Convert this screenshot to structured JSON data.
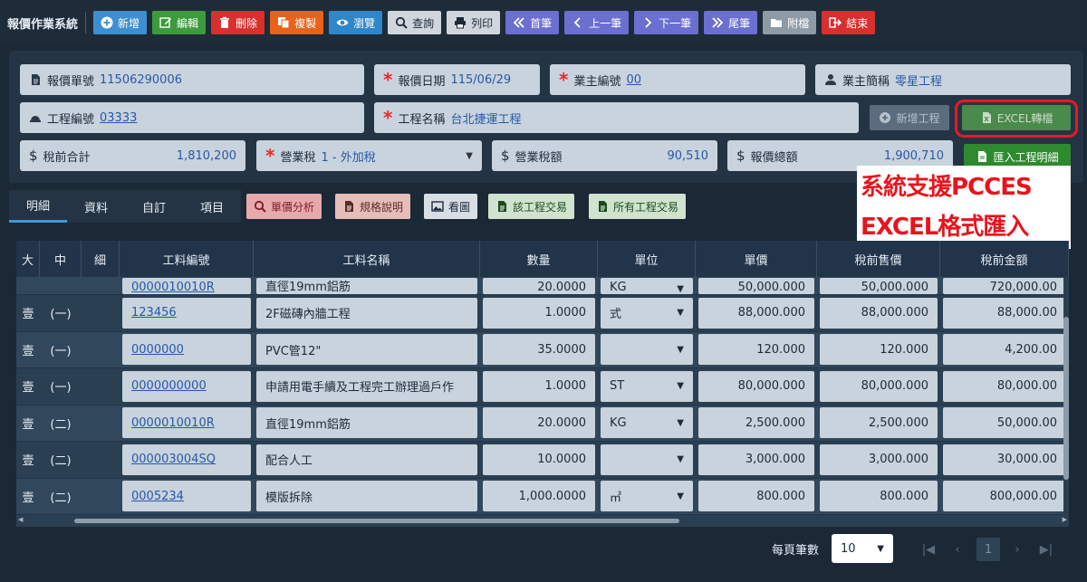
{
  "app_title": "報價作業系統",
  "toolbar": [
    {
      "name": "add-button",
      "label": "新增",
      "icon": "plus-circle-icon",
      "color": "c-blue"
    },
    {
      "name": "edit-button",
      "label": "編輯",
      "icon": "edit-icon",
      "color": "c-green"
    },
    {
      "name": "delete-button",
      "label": "刪除",
      "icon": "trash-icon",
      "color": "c-red"
    },
    {
      "name": "copy-button",
      "label": "複製",
      "icon": "copy-icon",
      "color": "c-orange"
    },
    {
      "name": "browse-button",
      "label": "瀏覽",
      "icon": "eye-icon",
      "color": "c-sky"
    },
    {
      "name": "query-button",
      "label": "查詢",
      "icon": "search-icon",
      "color": "c-gray"
    },
    {
      "name": "print-button",
      "label": "列印",
      "icon": "printer-icon",
      "color": "c-gray"
    },
    {
      "name": "first-record-button",
      "label": "首筆",
      "icon": "double-chevron-left-icon",
      "color": "c-purple"
    },
    {
      "name": "prev-record-button",
      "label": "上一筆",
      "icon": "chevron-left-icon",
      "color": "c-purple"
    },
    {
      "name": "next-record-button",
      "label": "下一筆",
      "icon": "chevron-right-icon",
      "color": "c-purple"
    },
    {
      "name": "last-record-button",
      "label": "尾筆",
      "icon": "double-chevron-right-icon",
      "color": "c-purple"
    },
    {
      "name": "attachment-button",
      "label": "附檔",
      "icon": "folder-icon",
      "color": "c-slate"
    },
    {
      "name": "exit-button",
      "label": "結束",
      "icon": "sign-out-icon",
      "color": "c-red"
    }
  ],
  "form": {
    "quote_no_label": "報價單號",
    "quote_no": "11506290006",
    "quote_date_label": "報價日期",
    "quote_date": "115/06/29",
    "owner_code_label": "業主編號",
    "owner_code": "00",
    "owner_name_label": "業主簡稱",
    "owner_name": "零星工程",
    "project_code_label": "工程編號",
    "project_code": "03333",
    "project_name_label": "工程名稱",
    "project_name": "台北捷運工程",
    "pretax_label": "稅前合計",
    "pretax": "1,810,200",
    "tax_type_label": "營業稅",
    "tax_type": "1 - 外加稅",
    "tax_amount_label": "營業稅額",
    "tax_amount": "90,510",
    "total_label": "報價總額",
    "total": "1,900,710"
  },
  "side_buttons": {
    "add_project": "新增工程",
    "excel": "EXCEL轉檔",
    "import": "匯入工程明細"
  },
  "callout": {
    "line1": "系統支援PCCES",
    "line2": "EXCEL格式匯入"
  },
  "tabs": [
    "明細",
    "資料",
    "自訂",
    "項目"
  ],
  "sub_buttons": [
    {
      "name": "unit-price-analysis-button",
      "label": "單價分析",
      "color": "c-pink",
      "icon": "search-icon"
    },
    {
      "name": "spec-description-button",
      "label": "規格說明",
      "color": "c-tan",
      "icon": "document-icon"
    },
    {
      "name": "view-image-button",
      "label": "看圖",
      "color": "c-lgray",
      "icon": "image-icon"
    },
    {
      "name": "project-transactions-button",
      "label": "該工程交易",
      "color": "c-lgreen",
      "icon": "document-icon"
    },
    {
      "name": "all-project-transactions-button",
      "label": "所有工程交易",
      "color": "c-lgreen",
      "icon": "document-icon"
    }
  ],
  "grid": {
    "columns": [
      "大",
      "中",
      "細",
      "工料編號",
      "工料名稱",
      "數量",
      "單位",
      "單價",
      "稅前售價",
      "稅前金額"
    ],
    "partial_row": {
      "code": "0000010010R",
      "name": "直徑19mm鋁筋",
      "qty": "20.0000",
      "unit": "KG",
      "price": "50,000.000",
      "sale": "50,000.000",
      "amount": "720,000.00"
    },
    "rows": [
      {
        "l1": "壹",
        "l2": "(一)",
        "l3": "",
        "code": "123456",
        "name": "2F磁磚內牆工程",
        "qty": "1.0000",
        "unit": "式",
        "price": "88,000.000",
        "sale": "88,000.000",
        "amount": "88,000.00"
      },
      {
        "l1": "壹",
        "l2": "(一)",
        "l3": "",
        "code": "0000000",
        "name": "PVC管12\"",
        "qty": "35.0000",
        "unit": "",
        "price": "120.000",
        "sale": "120.000",
        "amount": "4,200.00"
      },
      {
        "l1": "壹",
        "l2": "(一)",
        "l3": "",
        "code": "0000000000",
        "name": "申請用電手續及工程完工辦理過戶作",
        "qty": "1.0000",
        "unit": "ST",
        "price": "80,000.000",
        "sale": "80,000.000",
        "amount": "80,000.00"
      },
      {
        "l1": "壹",
        "l2": "(二)",
        "l3": "",
        "code": "0000010010R",
        "name": "直徑19mm鋁筋",
        "qty": "20.0000",
        "unit": "KG",
        "price": "2,500.000",
        "sale": "2,500.000",
        "amount": "50,000.00"
      },
      {
        "l1": "壹",
        "l2": "(二)",
        "l3": "",
        "code": "000003004SQ",
        "name": "配合人工",
        "qty": "10.0000",
        "unit": "",
        "price": "3,000.000",
        "sale": "3,000.000",
        "amount": "30,000.00"
      },
      {
        "l1": "壹",
        "l2": "(二)",
        "l3": "",
        "code": "0005234",
        "name": "模版拆除",
        "qty": "1,000.0000",
        "unit": "㎡",
        "price": "800.000",
        "sale": "800.000",
        "amount": "800,000.00"
      }
    ]
  },
  "pager": {
    "per_page_label": "每頁筆數",
    "per_page": "10",
    "current_page": "1"
  }
}
